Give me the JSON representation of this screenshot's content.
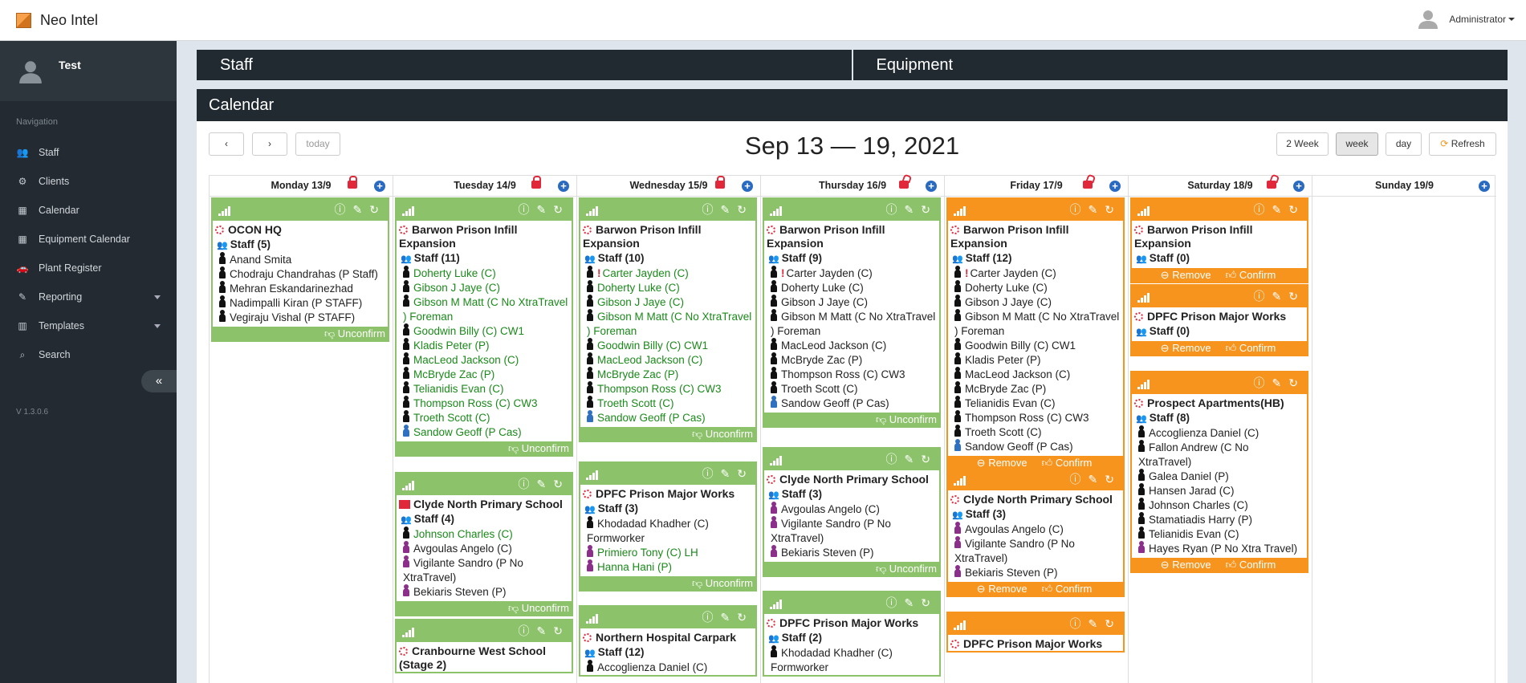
{
  "app": {
    "title": "Neo Intel",
    "user": "Administrator"
  },
  "sidebar": {
    "profile_name": "Test",
    "nav_heading": "Navigation",
    "version": "V 1.3.0.6",
    "items": [
      {
        "label": "Staff",
        "icon": "users-icon"
      },
      {
        "label": "Clients",
        "icon": "cogs-icon"
      },
      {
        "label": "Calendar",
        "icon": "calendar-icon"
      },
      {
        "label": "Equipment Calendar",
        "icon": "calendar-icon"
      },
      {
        "label": "Plant Register",
        "icon": "car-icon"
      },
      {
        "label": "Reporting",
        "icon": "edit-icon"
      },
      {
        "label": "Templates",
        "icon": "bar-chart-icon"
      },
      {
        "label": "Search",
        "icon": "search-icon"
      }
    ]
  },
  "tabs": {
    "staff": "Staff",
    "equipment": "Equipment"
  },
  "calendar": {
    "header": "Calendar",
    "title": "Sep 13 — 19, 2021",
    "today": "today",
    "prev": "‹",
    "next": "›",
    "two_week": "2 Week",
    "week": "week",
    "day": "day",
    "refresh": "Refresh",
    "days": [
      "Monday 13/9",
      "Tuesday 14/9",
      "Wednesday 15/9",
      "Thursday 16/9",
      "Friday 17/9",
      "Saturday 18/9",
      "Sunday 19/9"
    ]
  },
  "events": {
    "mon1": {
      "title": "OCON HQ",
      "staff": "Staff (5)",
      "people": [
        "Anand Smita",
        "Chodraju Chandrahas (P Staff)",
        "Mehran Eskandarinezhad",
        "Nadimpalli Kiran (P STAFF)",
        "Vegiraju Vishal (P STAFF)"
      ],
      "foot": "Unconfirm"
    },
    "tue1": {
      "title": "Barwon Prison Infill Expansion",
      "staff": "Staff (11)",
      "people": [
        "Doherty Luke (C)",
        "Gibson J Jaye (C)",
        "Gibson M Matt (C No XtraTravel ) Foreman",
        "Goodwin Billy (C) CW1",
        "Kladis Peter (P)",
        "MacLeod Jackson (C)",
        "McBryde Zac (P)",
        "Telianidis Evan (C)",
        "Thompson Ross (C) CW3",
        "Troeth Scott (C)",
        "Sandow Geoff (P Cas)"
      ],
      "foot": "Unconfirm"
    },
    "tue2": {
      "title": "Clyde North Primary School",
      "staff": "Staff (4)",
      "people": [
        "Johnson Charles (C)",
        "Avgoulas Angelo (C)",
        "Vigilante Sandro (P No XtraTravel)",
        "Bekiaris Steven (P)"
      ],
      "foot": "Unconfirm"
    },
    "tue3": {
      "title": "Cranbourne West School (Stage 2)"
    },
    "wed1": {
      "title": "Barwon Prison Infill Expansion",
      "staff": "Staff (10)",
      "people": [
        "Carter Jayden (C)",
        "Doherty Luke (C)",
        "Gibson J Jaye (C)",
        "Gibson M Matt (C No XtraTravel ) Foreman",
        "Goodwin Billy (C) CW1",
        "MacLeod Jackson (C)",
        "McBryde Zac (P)",
        "Thompson Ross (C) CW3",
        "Troeth Scott (C)",
        "Sandow Geoff (P Cas)"
      ],
      "foot": "Unconfirm"
    },
    "wed2": {
      "title": "DPFC Prison Major Works",
      "staff": "Staff (3)",
      "people": [
        "Khodadad Khadher (C) Formworker",
        "Primiero Tony (C) LH",
        "Hanna Hani (P)"
      ],
      "foot": "Unconfirm"
    },
    "wed3": {
      "title": "Northern Hospital Carpark",
      "staff": "Staff (12)",
      "people": [
        "Accoglienza Daniel (C)"
      ]
    },
    "thu1": {
      "title": "Barwon Prison Infill Expansion",
      "staff": "Staff (9)",
      "people": [
        "Carter Jayden (C)",
        "Doherty Luke (C)",
        "Gibson J Jaye (C)",
        "Gibson M Matt (C No XtraTravel ) Foreman",
        "MacLeod Jackson (C)",
        "McBryde Zac (P)",
        "Thompson Ross (C) CW3",
        "Troeth Scott (C)",
        "Sandow Geoff (P Cas)"
      ],
      "foot": "Unconfirm"
    },
    "thu2": {
      "title": "Clyde North Primary School",
      "staff": "Staff (3)",
      "people": [
        "Avgoulas Angelo (C)",
        "Vigilante Sandro (P No XtraTravel)",
        "Bekiaris Steven (P)"
      ],
      "foot": "Unconfirm"
    },
    "thu3": {
      "title": "DPFC Prison Major Works",
      "staff": "Staff (2)",
      "people": [
        "Khodadad Khadher (C) Formworker"
      ]
    },
    "fri1": {
      "title": "Barwon Prison Infill Expansion",
      "staff": "Staff (12)",
      "people": [
        "Carter Jayden (C)",
        "Doherty Luke (C)",
        "Gibson J Jaye (C)",
        "Gibson M Matt (C No XtraTravel ) Foreman",
        "Goodwin Billy (C) CW1",
        "Kladis Peter (P)",
        "MacLeod Jackson (C)",
        "McBryde Zac (P)",
        "Telianidis Evan (C)",
        "Thompson Ross (C) CW3",
        "Troeth Scott (C)",
        "Sandow Geoff (P Cas)"
      ],
      "remove": "Remove",
      "confirm": "Confirm"
    },
    "fri2": {
      "title": "Clyde North Primary School",
      "staff": "Staff (3)",
      "people": [
        "Avgoulas Angelo (C)",
        "Vigilante Sandro (P No XtraTravel)",
        "Bekiaris Steven (P)"
      ],
      "remove": "Remove",
      "confirm": "Confirm"
    },
    "fri3": {
      "title": "DPFC Prison Major Works"
    },
    "sat1": {
      "title": "Barwon Prison Infill Expansion",
      "staff": "Staff (0)",
      "remove": "Remove",
      "confirm": "Confirm"
    },
    "sat2": {
      "title": "DPFC Prison Major Works",
      "staff": "Staff (0)",
      "remove": "Remove",
      "confirm": "Confirm"
    },
    "sat3": {
      "title": "Prospect Apartments(HB)",
      "staff": "Staff (8)",
      "people": [
        "Accoglienza Daniel (C)",
        "Fallon Andrew (C No XtraTravel)",
        "Galea Daniel (P)",
        "Hansen Jarad (C)",
        "Johnson Charles (C)",
        "Stamatiadis Harry (P)",
        "Telianidis Evan (C)",
        "Hayes Ryan (P No Xtra Travel)"
      ],
      "remove": "Remove",
      "confirm": "Confirm"
    }
  }
}
